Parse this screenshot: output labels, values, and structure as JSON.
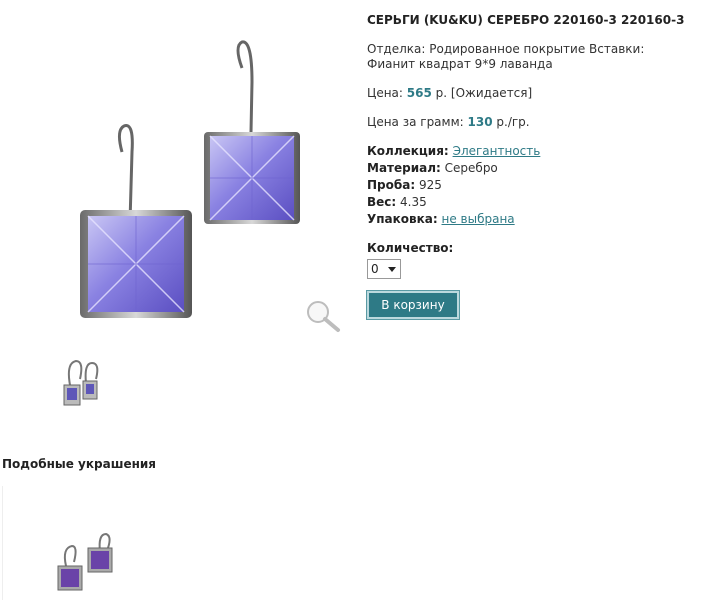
{
  "product": {
    "title": "СЕРЬГИ (KU&KU) СЕРЕБРО 220160-3 220160-3",
    "finish_text": "Отделка: Родированное покрытие Вставки: Фианит квадрат 9*9 лаванда",
    "price_label": "Цена:",
    "price_value": "565",
    "price_suffix": "р. [Ожидается]",
    "per_gram_label": "Цена за грамм:",
    "per_gram_value": "130",
    "per_gram_suffix": "р./гр.",
    "properties": {
      "collection_label": "Коллекция:",
      "collection_value": "Элегантность",
      "material_label": "Материал:",
      "material_value": "Серебро",
      "sample_label": "Проба:",
      "sample_value": "925",
      "weight_label": "Вес:",
      "weight_value": "4.35",
      "packaging_label": "Упаковка:",
      "packaging_value": "не выбрана"
    },
    "quantity_label": "Количество:",
    "quantity_value": "0",
    "cart_button": "В корзину"
  },
  "similar": {
    "title": "Подобные украшения"
  },
  "icons": {
    "zoom": "magnifier-icon",
    "dropdown": "chevron-down-icon"
  },
  "colors": {
    "accent": "#2e7a86",
    "stone": "#8c86e0"
  }
}
